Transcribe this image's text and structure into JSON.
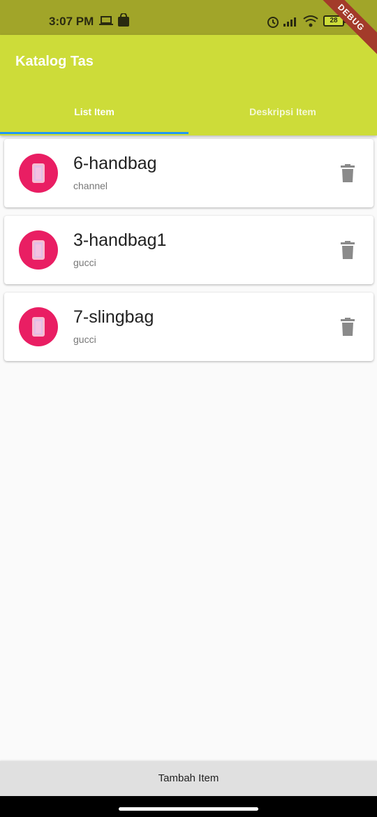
{
  "status_bar": {
    "time": "3:07 PM",
    "battery": "28",
    "icons": [
      "laptop-icon",
      "shopping-bag-icon",
      "alarm-icon",
      "signal-icon",
      "wifi-icon",
      "battery-icon"
    ]
  },
  "debug_banner": "DEBUG",
  "app_bar": {
    "title": "Katalog Tas",
    "tabs": [
      {
        "label": "List Item",
        "active": true
      },
      {
        "label": "Deskripsi Item",
        "active": false
      }
    ]
  },
  "items": [
    {
      "title": "6-handbag",
      "subtitle": "channel",
      "icon": "phone-icon",
      "action_icon": "trash-icon"
    },
    {
      "title": "3-handbag1",
      "subtitle": "gucci",
      "icon": "phone-icon",
      "action_icon": "trash-icon"
    },
    {
      "title": "7-slingbag",
      "subtitle": "gucci",
      "icon": "phone-icon",
      "action_icon": "trash-icon"
    }
  ],
  "bottom_button": "Tambah Item",
  "colors": {
    "status_bar": "#a1a529",
    "app_bar": "#cddc39",
    "tab_indicator": "#2196f3",
    "avatar": "#e91e63",
    "delete_icon": "#8a8a8a",
    "bottom_button_bg": "#e0e0e0"
  }
}
